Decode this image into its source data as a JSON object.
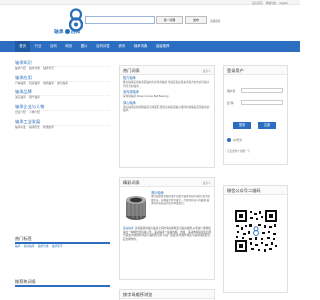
{
  "topbar": {
    "links": [
      "设为首页",
      "网站导航",
      "English"
    ]
  },
  "logo": {
    "text_left": "轴承",
    "text_right": "百科",
    "icon": "bearing-8-logo-icon"
  },
  "search": {
    "placeholder": "",
    "search_label": "搜 / 词典",
    "publish_label": "发布",
    "advanced_label": "高级搜索"
  },
  "nav": {
    "items": [
      "首页",
      "行业",
      "百科",
      "网页",
      "图片",
      "百科问答",
      "资讯",
      "轴承词典",
      "高级推荐"
    ]
  },
  "sidebar": {
    "groups": [
      {
        "title": "轴承知识",
        "links": [
          "轴承介绍",
          "轴承分类",
          "轴承代号"
        ]
      },
      {
        "title": "轴承应用",
        "links": [
          "汽车轴承",
          "机床轴承",
          "电机轴承",
          "航空轴承"
        ]
      },
      {
        "title": "轴承品牌",
        "links": [
          "进口轴承",
          "国产轴承"
        ]
      },
      {
        "title": "轴承企业与人物",
        "links": [
          "企业介绍",
          "人物介绍"
        ]
      },
      {
        "title": "轴承工业发展",
        "links": [
          "轴承标准",
          "轴承历史",
          "检测技术"
        ]
      }
    ]
  },
  "hot_section": {
    "title": "热门标签",
    "links": [
      "轴承",
      "滚动轴承",
      "轴承分类",
      "轴承型号"
    ]
  },
  "recommend_section": {
    "title": "推荐热词条"
  },
  "hot_card": {
    "title": "热门词条",
    "more": "更多>>",
    "entries": [
      {
        "title": "推力轴承",
        "desc": "推力轴承是用来承受轴向力的专用轴承,也就是说是用来承受力的方向与轴平行的力的轴承。"
      },
      {
        "title": "深沟球轴承",
        "desc": "深沟球轴承 (Deep Groove Ball Bearing)"
      },
      {
        "title": "调心轴承",
        "desc": "调心轴承是指外圈滚道为球面形,能适应两滚道轴心线间的角偏差及角运动的轴承。"
      }
    ]
  },
  "pick_card": {
    "title": "精彩词条",
    "more": "更多>>",
    "name": "滚针轴承",
    "desc": "滚针轴承是带圆柱滚子的滚子轴承,相对其直径,滚子既细又长。这种滚子称为滚针。尽管具有较小的截面,轴承仍具有较高的负荷承受能力。",
    "list_lead": "滚动轴承:",
    "list_text": "是将运转的轴与轴座之间的滑动摩擦变为滚动摩擦,从而减少摩擦损失的一种精密的机械元件。滚动轴承一般由内圈、外圈、滚动体和保持架四部分组成,内圈的作用是与轴相配合并与轴一起旋转;外圈作用是与轴承座相配合,起支撑作用。"
  },
  "latest_card": {
    "title": "按字母顺序浏览",
    "more": ""
  },
  "login": {
    "title": "登录用户",
    "user_label": "用户名:",
    "pass_label": "密  码:",
    "login_label": "登录",
    "register_label": "注册",
    "qq_label": "QQ登录",
    "forgot_label": "忘记密码?  注册一下"
  },
  "qr": {
    "title": "微信公众号二维码"
  }
}
